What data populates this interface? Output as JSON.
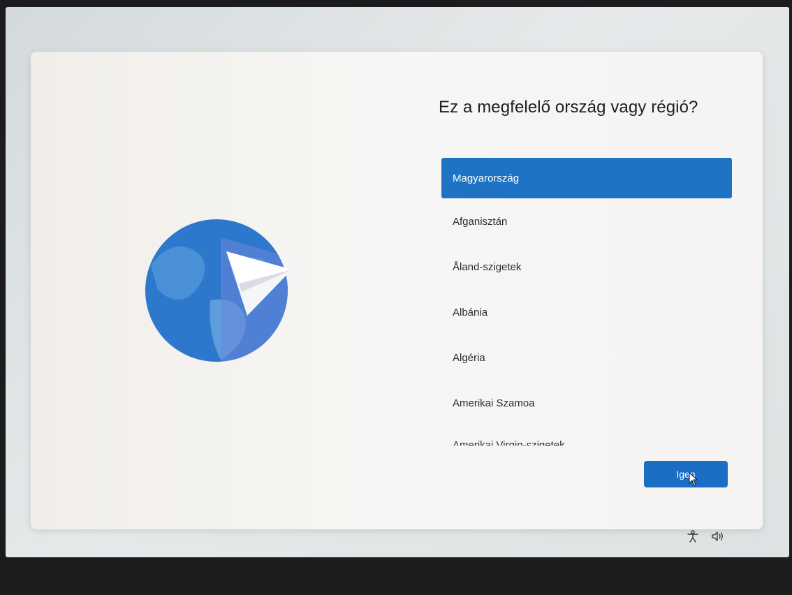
{
  "dialog": {
    "title": "Ez a megfelelő ország vagy régió?",
    "countries": [
      {
        "label": "Magyarország",
        "selected": true
      },
      {
        "label": "Afganisztán",
        "selected": false
      },
      {
        "label": "Åland-szigetek",
        "selected": false
      },
      {
        "label": "Albánia",
        "selected": false
      },
      {
        "label": "Algéria",
        "selected": false
      },
      {
        "label": "Amerikai Szamoa",
        "selected": false
      },
      {
        "label": "Amerikai Virgin-szigetek",
        "selected": false
      }
    ],
    "confirm_label": "Igen"
  },
  "illustration": {
    "icon": "globe-paper-plane-icon"
  },
  "tray": {
    "icons": [
      "accessibility-icon",
      "volume-icon"
    ]
  },
  "colors": {
    "accent": "#1f73c4",
    "globe_dark": "#2d78cc",
    "globe_light": "#5ea1dd",
    "card": "#f5f4f2"
  }
}
